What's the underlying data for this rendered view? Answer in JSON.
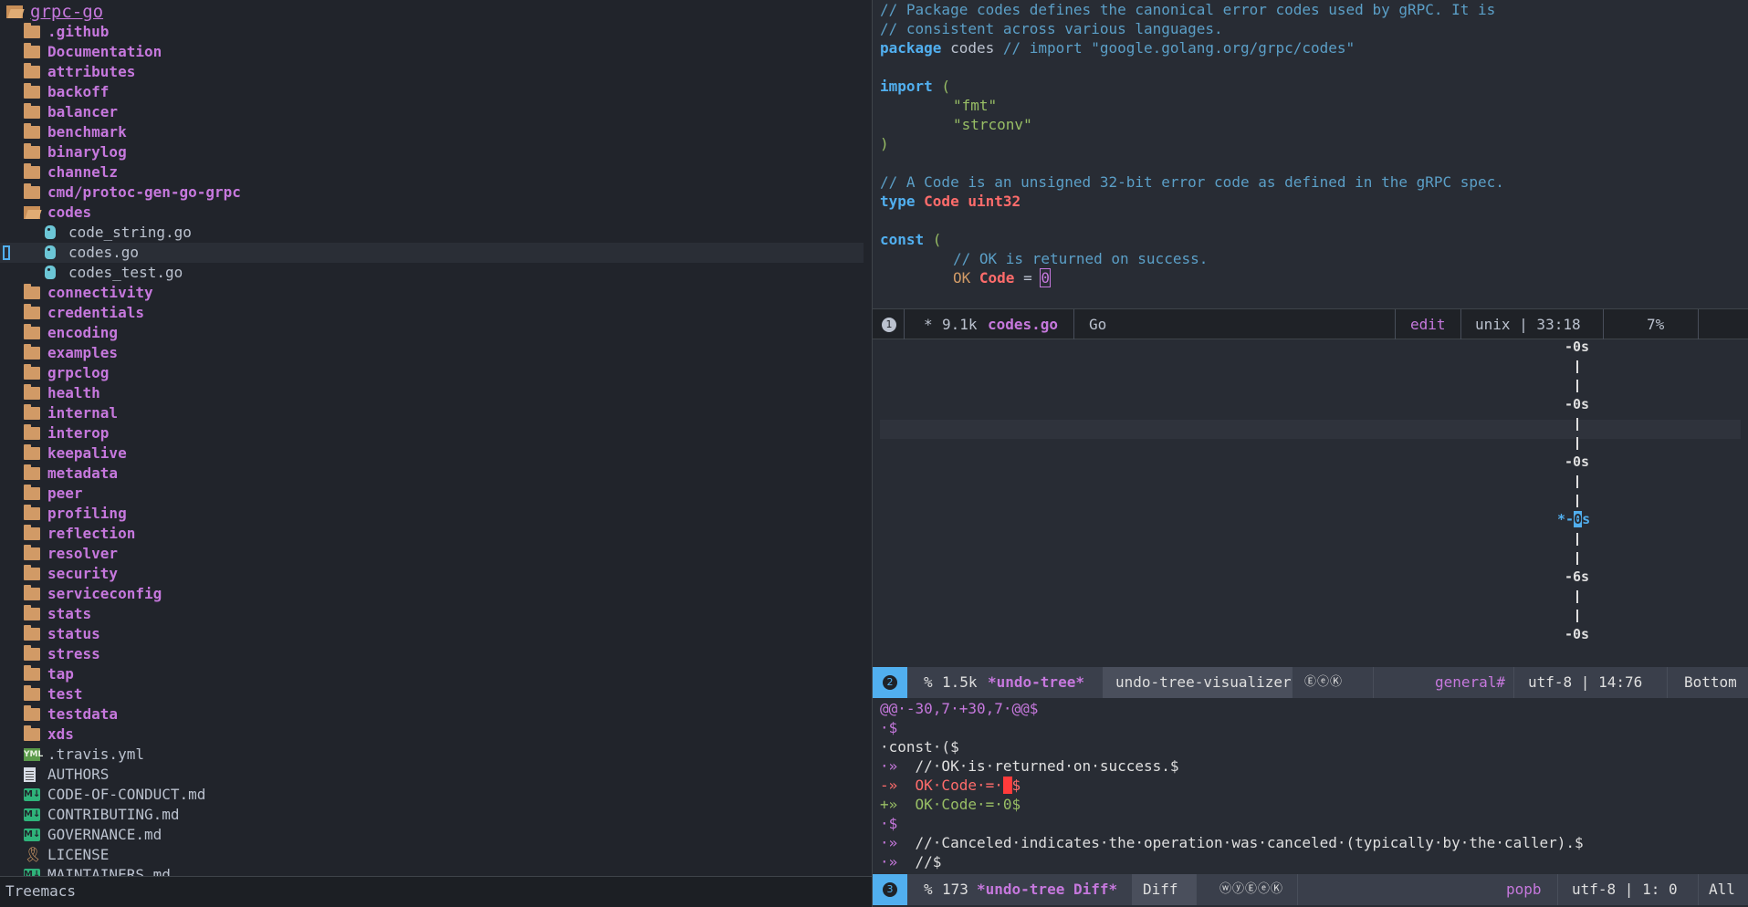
{
  "treemacs": {
    "root": "grpc-go",
    "dirs_before": [
      ".github",
      "Documentation",
      "attributes",
      "backoff",
      "balancer",
      "benchmark",
      "binarylog",
      "channelz",
      "cmd/protoc-gen-go-grpc"
    ],
    "open_dir": "codes",
    "open_dir_files": [
      "code_string.go",
      "codes.go",
      "codes_test.go"
    ],
    "selected_file": "codes.go",
    "dirs_after": [
      "connectivity",
      "credentials",
      "encoding",
      "examples",
      "grpclog",
      "health",
      "internal",
      "interop",
      "keepalive",
      "metadata",
      "peer",
      "profiling",
      "reflection",
      "resolver",
      "security",
      "serviceconfig",
      "stats",
      "status",
      "stress",
      "tap",
      "test",
      "testdata",
      "xds"
    ],
    "files": [
      {
        "name": ".travis.yml",
        "icon": "yaml-icon"
      },
      {
        "name": "AUTHORS",
        "icon": "text-file-icon"
      },
      {
        "name": "CODE-OF-CONDUCT.md",
        "icon": "markdown-icon"
      },
      {
        "name": "CONTRIBUTING.md",
        "icon": "markdown-icon"
      },
      {
        "name": "GOVERNANCE.md",
        "icon": "markdown-icon"
      },
      {
        "name": "LICENSE",
        "icon": "license-icon"
      },
      {
        "name": "MAINTAINERS.md",
        "icon": "markdown-icon"
      }
    ],
    "modeline": "Treemacs"
  },
  "code": {
    "line1": "// Package codes defines the canonical error codes used by gRPC. It is",
    "line2": "// consistent across various languages.",
    "line3_kw": "package",
    "line3_name": " codes ",
    "line3_cmt": "// import \"google.golang.org/grpc/codes\"",
    "line5_kw": "import",
    "line5_paren": " (",
    "line6": "\"fmt\"",
    "line7": "\"strconv\"",
    "line8": ")",
    "line10": "// A Code is an unsigned 32-bit error code as defined in the gRPC spec.",
    "line11_kw": "type",
    "line11_type": " Code uint32",
    "line13_kw": "const",
    "line13_paren": " (",
    "line14": "// OK is returned on success.",
    "line15_const": "OK",
    "line15_type": " Code",
    "line15_eq": " = ",
    "line15_val": "0"
  },
  "modeline1": {
    "window": "1",
    "state": "*",
    "size": "9.1k",
    "buffer": "codes.go",
    "mode": "Go",
    "edit": "edit",
    "eol_pos": "unix | 33:18",
    "percent": "7%"
  },
  "undo_tree": {
    "nodes": [
      "-0s",
      "-0s",
      "-0s",
      "*-0s",
      "-6s",
      "-0s"
    ],
    "current_prefix": "*-",
    "current_digit": "0",
    "current_suffix": "s"
  },
  "modeline2": {
    "window": "2",
    "state": "%",
    "size": "1.5k",
    "buffer": "*undo-tree*",
    "mode": "undo-tree-visualizer",
    "flags": "ⒺⓔⓀ",
    "workspace": "general#",
    "enc_pos": "utf-8 | 14:76",
    "position": "Bottom"
  },
  "diff": {
    "hunk": "@@·-30,7·+30,7·@@$",
    "l2": "·$",
    "l3_a": "·const·($",
    "l4_a": "·»",
    "l4_b": "  //·OK·is·returned·on·success.$",
    "l5_a": "-»",
    "l5_b": "  OK·Code·=·",
    "l5_c": "$",
    "l6_a": "+»",
    "l6_b": "  OK·Code·=·0$",
    "l7": "·$",
    "l8_a": "·»",
    "l8_b": "  //·Canceled·indicates·the·operation·was·canceled·(typically·by·the·caller).$",
    "l9_a": "·»",
    "l9_b": "  //$"
  },
  "modeline3": {
    "window": "3",
    "state": "%",
    "size": "173",
    "buffer": "*undo-tree Diff*",
    "mode": "Diff",
    "flags": "ⓦⓨⒺⓔⓀ",
    "workspace": "popb",
    "enc_pos": "utf-8 | 1: 0",
    "position": "All"
  },
  "colors": {
    "background": "#282c34",
    "sidebar_bg": "#21242b",
    "directory": "#c678dd",
    "comment": "#5b9fc7",
    "keyword": "#51afef",
    "type": "#ff6c6b",
    "string": "#98be65",
    "active_window": "#51afef"
  }
}
